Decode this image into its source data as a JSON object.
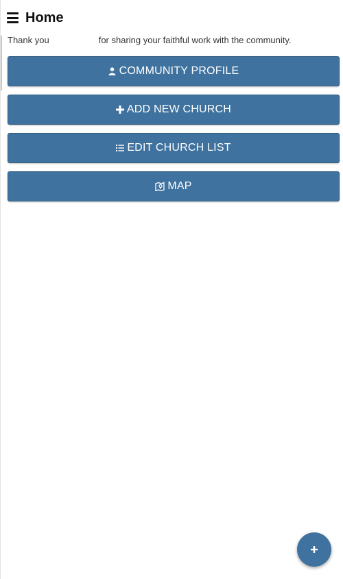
{
  "header": {
    "title": "Home",
    "menu_icon": "hamburger-menu-icon"
  },
  "intro": {
    "text_before": "Thank you",
    "text_after": "for sharing your faithful work with the community."
  },
  "buttons": {
    "community_profile": {
      "label": "COMMUNITY PROFILE",
      "icon": "user-icon"
    },
    "add_new_church": {
      "label": "ADD NEW CHURCH",
      "icon": "plus-icon"
    },
    "edit_church_list": {
      "label": "EDIT CHURCH LIST",
      "icon": "list-icon"
    },
    "map": {
      "label": "MAP",
      "icon": "map-icon"
    }
  },
  "fab": {
    "icon": "plus-icon"
  },
  "colors": {
    "button_background": "#3f729e",
    "button_text": "#ffffff",
    "page_background": "#ffffff"
  }
}
